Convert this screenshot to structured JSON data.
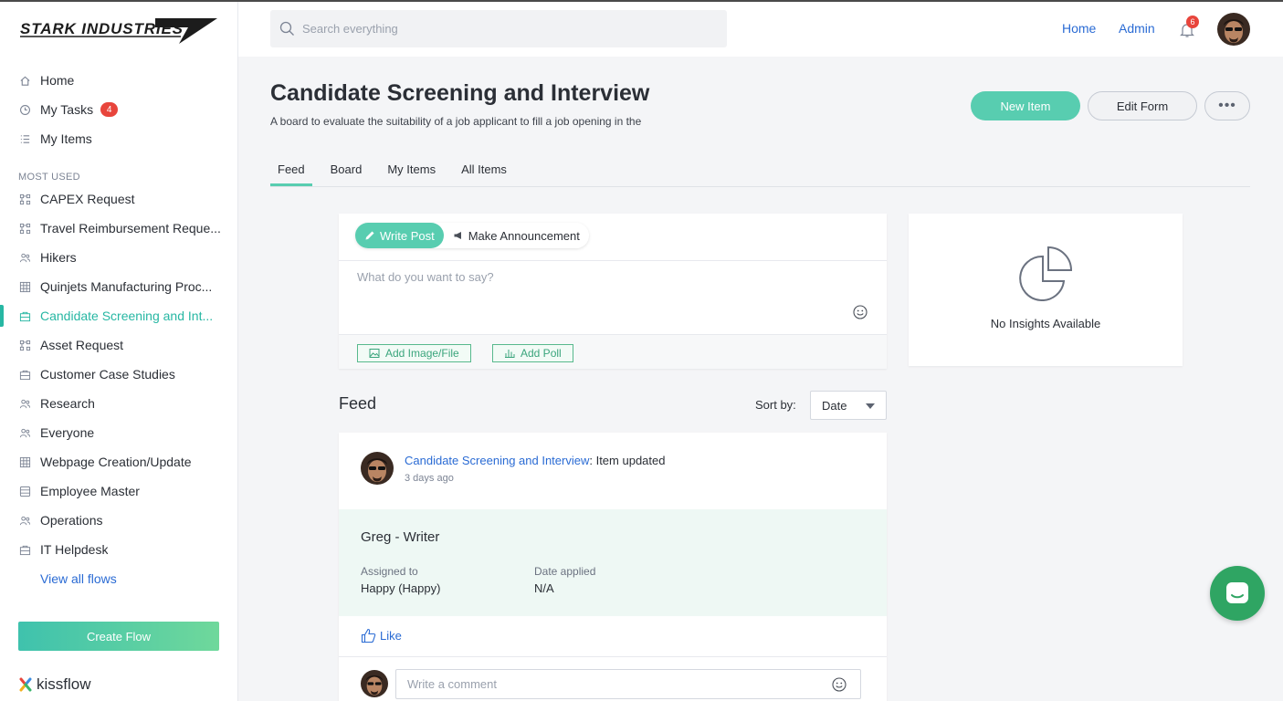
{
  "brand": {
    "logo_text": "STARK INDUSTRIES",
    "accent": "#58cdb0",
    "link": "#2a6bd4"
  },
  "sidebar": {
    "top_items": [
      {
        "label": "Home",
        "icon": "home-icon"
      },
      {
        "label": "My Tasks",
        "icon": "clock-icon",
        "badge": "4"
      },
      {
        "label": "My Items",
        "icon": "list-icon"
      }
    ],
    "section_label": "MOST USED",
    "flows": [
      {
        "label": "CAPEX Request",
        "icon": "process-icon"
      },
      {
        "label": "Travel Reimbursement Reque...",
        "icon": "process-icon"
      },
      {
        "label": "Hikers",
        "icon": "users-icon"
      },
      {
        "label": "Quinjets Manufacturing Proc...",
        "icon": "grid-icon"
      },
      {
        "label": "Candidate Screening and Int...",
        "icon": "board-icon",
        "active": true
      },
      {
        "label": "Asset Request",
        "icon": "process-icon"
      },
      {
        "label": "Customer Case Studies",
        "icon": "board-icon"
      },
      {
        "label": "Research",
        "icon": "users-icon"
      },
      {
        "label": "Everyone",
        "icon": "users-icon"
      },
      {
        "label": "Webpage Creation/Update",
        "icon": "grid-icon"
      },
      {
        "label": "Employee Master",
        "icon": "database-icon"
      },
      {
        "label": "Operations",
        "icon": "users-icon"
      },
      {
        "label": "IT Helpdesk",
        "icon": "board-icon"
      }
    ],
    "view_all": "View all flows",
    "create_flow": "Create Flow",
    "footer_brand": "kissflow"
  },
  "topbar": {
    "search_placeholder": "Search everything",
    "links": [
      "Home",
      "Admin"
    ],
    "notification_count": "6"
  },
  "page": {
    "title": "Candidate Screening and Interview",
    "description": "A board to evaluate the suitability of a job applicant to fill a job opening in the",
    "actions": {
      "new_item": "New Item",
      "edit_form": "Edit Form",
      "more": "•••"
    },
    "tabs": [
      "Feed",
      "Board",
      "My Items",
      "All Items"
    ],
    "active_tab": "Feed"
  },
  "composer": {
    "tabs": [
      "Write Post",
      "Make Announcement"
    ],
    "placeholder": "What do you want to say?",
    "add_file": "Add Image/File",
    "add_poll": "Add Poll"
  },
  "insights": {
    "text": "No Insights Available"
  },
  "feed": {
    "title": "Feed",
    "sort_label": "Sort by:",
    "sort_value": "Date",
    "post": {
      "link": "Candidate Screening and Interview",
      "action": ": Item updated",
      "time": "3 days ago",
      "item_title": "Greg - Writer",
      "fields": [
        {
          "label": "Assigned to",
          "value": "Happy (Happy)"
        },
        {
          "label": "Date applied",
          "value": "N/A"
        }
      ],
      "like": "Like",
      "comment_placeholder": "Write a comment"
    }
  }
}
